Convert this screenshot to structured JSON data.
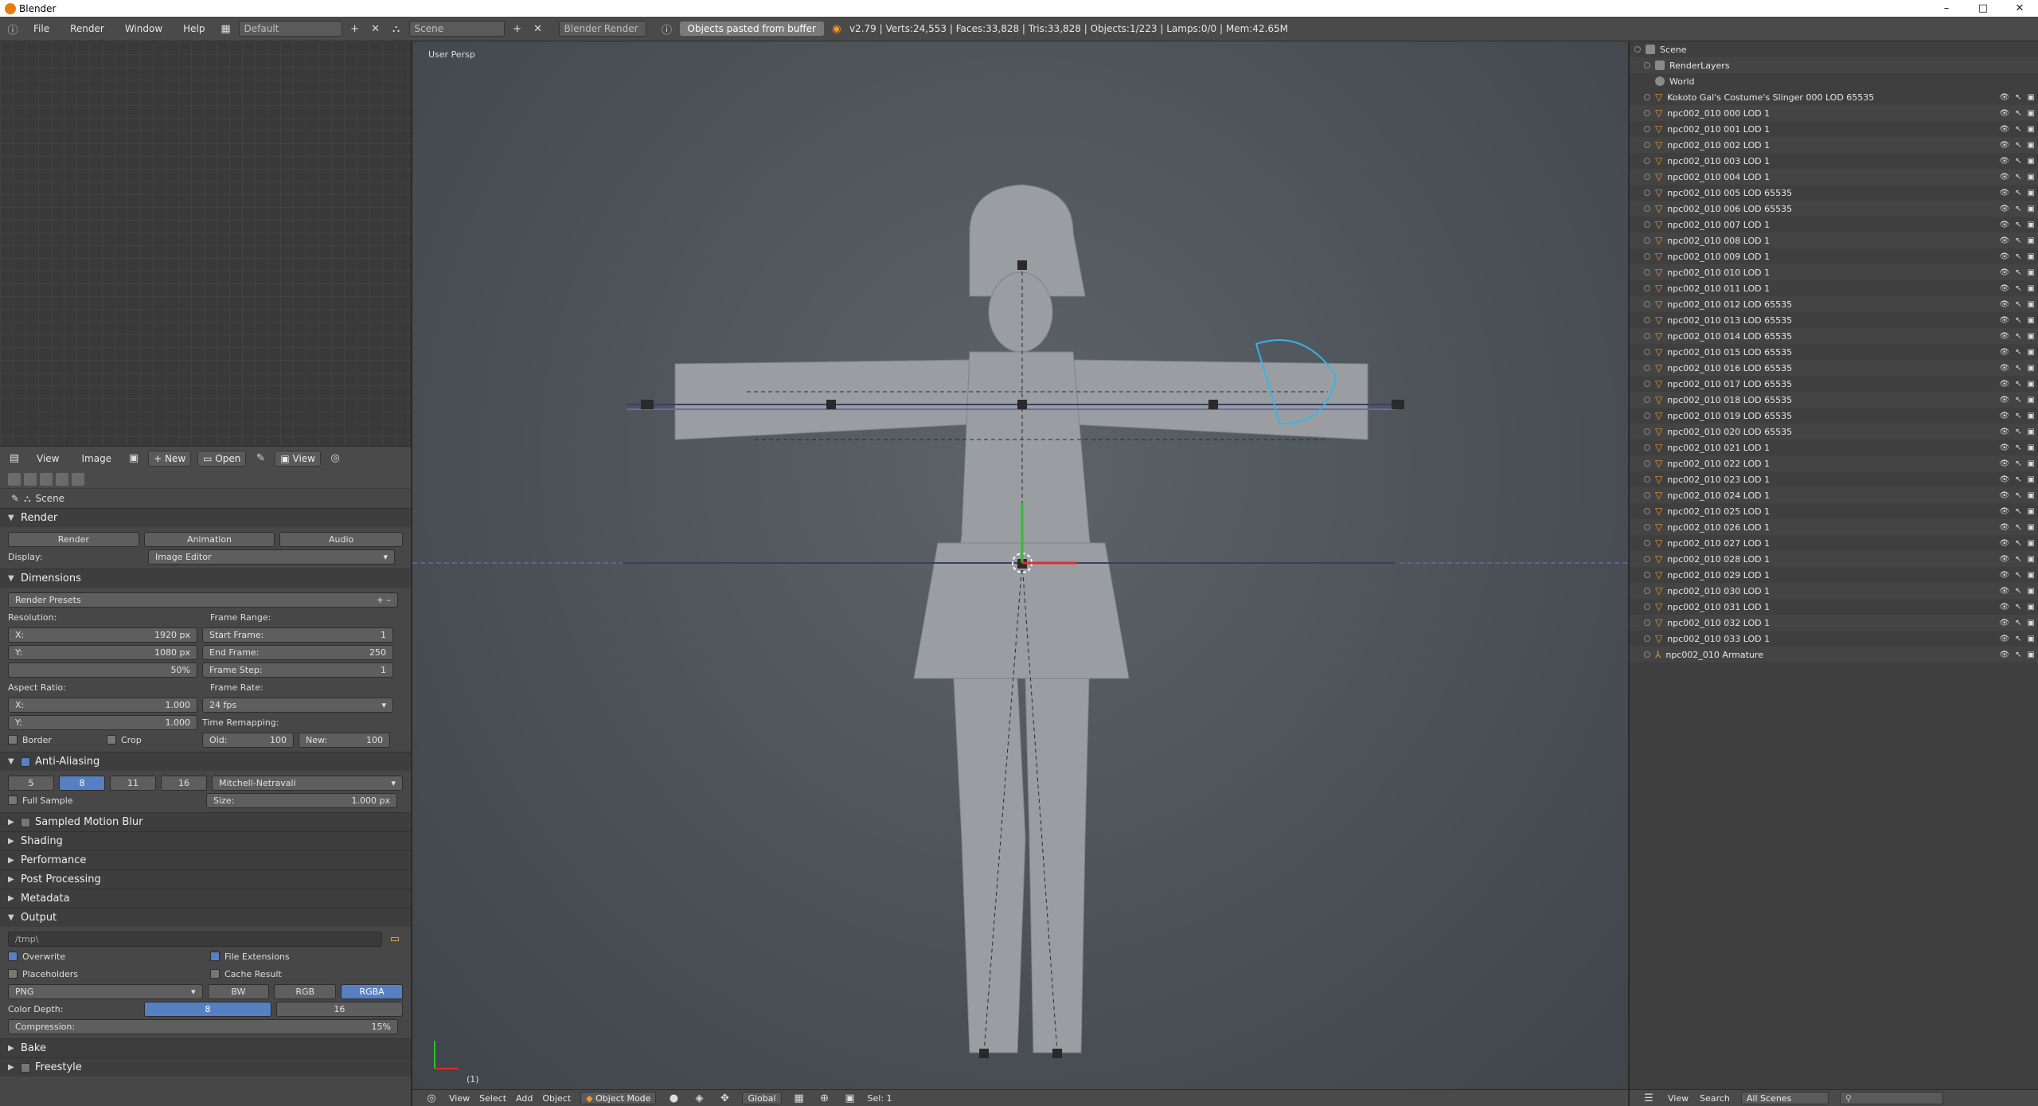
{
  "window": {
    "title": "Blender",
    "controls": [
      "–",
      "□",
      "✕"
    ]
  },
  "info_header": {
    "menus": [
      "File",
      "Render",
      "Window",
      "Help"
    ],
    "layout": "Default",
    "scene": "Scene",
    "engine": "Blender Render",
    "report": "Objects pasted from buffer",
    "stats": "v2.79 | Verts:24,553 | Faces:33,828 | Tris:33,828 | Objects:1/223 | Lamps:0/0 | Mem:42.65M"
  },
  "image_editor": {
    "menus": [
      "View",
      "Image"
    ],
    "new_label": "New",
    "open_label": "Open",
    "view_label": "View"
  },
  "properties": {
    "context": "Scene",
    "render": {
      "title": "Render",
      "render_btn": "Render",
      "animation_btn": "Animation",
      "audio_btn": "Audio",
      "display_label": "Display:",
      "display_value": "Image Editor"
    },
    "dimensions": {
      "title": "Dimensions",
      "presets": "Render Presets",
      "resolution_label": "Resolution:",
      "res_x": "1920 px",
      "res_y": "1080 px",
      "res_pct": "50%",
      "frame_range_label": "Frame Range:",
      "start_frame_label": "Start Frame:",
      "start_frame": "1",
      "end_frame_label": "End Frame:",
      "end_frame": "250",
      "frame_step_label": "Frame Step:",
      "frame_step": "1",
      "aspect_label": "Aspect Ratio:",
      "aspect_x": "1.000",
      "aspect_y": "1.000",
      "frame_rate_label": "Frame Rate:",
      "frame_rate": "24 fps",
      "time_remap_label": "Time Remapping:",
      "old_label": "Old:",
      "old": "100",
      "new_label": "New:",
      "new": "100",
      "border_label": "Border",
      "crop_label": "Crop",
      "x_label": "X:",
      "y_label": "Y:"
    },
    "anti_aliasing": {
      "title": "Anti-Aliasing",
      "samples": [
        "5",
        "8",
        "11",
        "16"
      ],
      "filter": "Mitchell-Netravali",
      "full_sample": "Full Sample",
      "size_label": "Size:",
      "size": "1.000 px"
    },
    "collapsed_panels": [
      "Sampled Motion Blur",
      "Shading",
      "Performance",
      "Post Processing",
      "Metadata"
    ],
    "output": {
      "title": "Output",
      "path": "/tmp\\",
      "overwrite": "Overwrite",
      "file_extensions": "File Extensions",
      "placeholders": "Placeholders",
      "cache_result": "Cache Result",
      "format": "PNG",
      "modes": [
        "BW",
        "RGB",
        "RGBA"
      ],
      "color_depth_label": "Color Depth:",
      "depths": [
        "8",
        "16"
      ],
      "compression_label": "Compression:",
      "compression": "15%"
    },
    "bottom_panels": [
      "Bake",
      "Freestyle"
    ]
  },
  "viewport": {
    "label": "User Persp",
    "frame": "(1)",
    "menus": [
      "View",
      "Select",
      "Add",
      "Object"
    ],
    "mode": "Object Mode",
    "orientation": "Global",
    "sel": "Sel: 1"
  },
  "outliner": {
    "scene": "Scene",
    "render_layers": "RenderLayers",
    "world": "World",
    "objects": [
      "Kokoto Gal's Costume's Slinger 000 LOD 65535",
      "npc002_010 000 LOD 1",
      "npc002_010 001 LOD 1",
      "npc002_010 002 LOD 1",
      "npc002_010 003 LOD 1",
      "npc002_010 004 LOD 1",
      "npc002_010 005 LOD 65535",
      "npc002_010 006 LOD 65535",
      "npc002_010 007 LOD 1",
      "npc002_010 008 LOD 1",
      "npc002_010 009 LOD 1",
      "npc002_010 010 LOD 1",
      "npc002_010 011 LOD 1",
      "npc002_010 012 LOD 65535",
      "npc002_010 013 LOD 65535",
      "npc002_010 014 LOD 65535",
      "npc002_010 015 LOD 65535",
      "npc002_010 016 LOD 65535",
      "npc002_010 017 LOD 65535",
      "npc002_010 018 LOD 65535",
      "npc002_010 019 LOD 65535",
      "npc002_010 020 LOD 65535",
      "npc002_010 021 LOD 1",
      "npc002_010 022 LOD 1",
      "npc002_010 023 LOD 1",
      "npc002_010 024 LOD 1",
      "npc002_010 025 LOD 1",
      "npc002_010 026 LOD 1",
      "npc002_010 027 LOD 1",
      "npc002_010 028 LOD 1",
      "npc002_010 029 LOD 1",
      "npc002_010 030 LOD 1",
      "npc002_010 031 LOD 1",
      "npc002_010 032 LOD 1",
      "npc002_010 033 LOD 1",
      "npc002_010 Armature"
    ],
    "header_menus": [
      "View",
      "Search"
    ],
    "filter": "All Scenes"
  }
}
